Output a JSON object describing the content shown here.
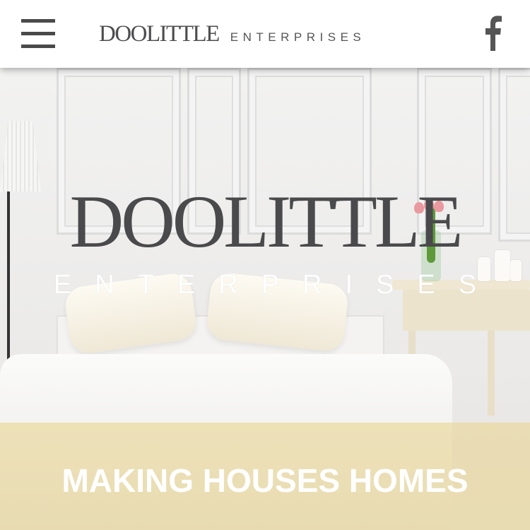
{
  "header": {
    "menu_icon": "hamburger-menu-icon",
    "brand_main": "DOOLITTLE",
    "brand_sub": "ENTERPRISES",
    "social_icon": "facebook-icon"
  },
  "hero": {
    "title": "DOOLITTLE",
    "subtitle": "ENTERPRISES",
    "tagline": "MAKING HOUSES HOMES"
  },
  "colors": {
    "brand_gray": "#4a4a4c",
    "tagline_band": "#e9d692",
    "tagline_text": "#ffffff"
  }
}
